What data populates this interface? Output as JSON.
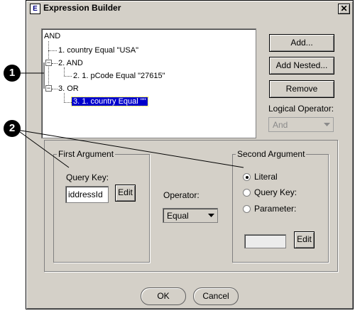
{
  "window": {
    "title": "Expression Builder",
    "close_glyph": "✕",
    "icon_glyph": "E"
  },
  "tree": {
    "root": "AND",
    "node1": "1. country Equal \"USA\"",
    "node2": "2. AND",
    "node2_child": "2. 1. pCode Equal \"27615\"",
    "node3": "3. OR",
    "node3_child": "3. 1. country Equal \"\"",
    "expander_glyph": "−"
  },
  "buttons": {
    "add": "Add...",
    "add_nested": "Add Nested...",
    "remove": "Remove",
    "ok": "OK",
    "cancel": "Cancel"
  },
  "logical_operator": {
    "label": "Logical Operator:",
    "value": "And"
  },
  "first_argument": {
    "legend": "First Argument",
    "query_key_label": "Query Key:",
    "query_key_value": "iddressId",
    "edit": "Edit"
  },
  "operator": {
    "label": "Operator:",
    "value": "Equal"
  },
  "second_argument": {
    "legend": "Second Argument",
    "literal": "Literal",
    "query_key": "Query Key:",
    "parameter": "Parameter:",
    "literal_value": "",
    "edit": "Edit"
  },
  "callouts": {
    "one": "1",
    "two": "2"
  },
  "icons": [
    "dropdown-arrow-icon",
    "close-icon",
    "window-icon"
  ]
}
